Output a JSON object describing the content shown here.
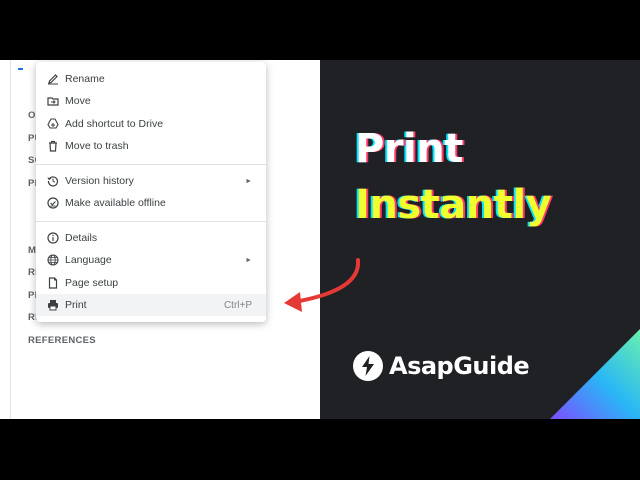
{
  "document": {
    "outline_items": [
      "OV",
      "PU",
      "SC",
      "PR",
      "MA",
      "RE",
      "PR",
      "RI",
      "REFERENCES"
    ]
  },
  "context_menu": {
    "groups": [
      [
        {
          "label": "Rename",
          "icon": "rename-icon"
        },
        {
          "label": "Move",
          "icon": "move-icon"
        },
        {
          "label": "Add shortcut to Drive",
          "icon": "add-shortcut-icon"
        },
        {
          "label": "Move to trash",
          "icon": "trash-icon"
        }
      ],
      [
        {
          "label": "Version history",
          "icon": "version-history-icon",
          "submenu": true
        },
        {
          "label": "Make available offline",
          "icon": "offline-icon"
        }
      ],
      [
        {
          "label": "Details",
          "icon": "info-icon"
        },
        {
          "label": "Language",
          "icon": "globe-icon",
          "submenu": true
        },
        {
          "label": "Page setup",
          "icon": "page-setup-icon"
        },
        {
          "label": "Print",
          "icon": "print-icon",
          "shortcut": "Ctrl+P",
          "highlighted": true
        }
      ]
    ],
    "submenu_arrow": "►"
  },
  "promo": {
    "line1": "Print",
    "line2": "Instantly",
    "brand": "AsapGuide",
    "colors": {
      "background": "#202124",
      "line1": "#ffffff",
      "line2": "#f0ff2e",
      "arrow": "#e53935"
    }
  }
}
